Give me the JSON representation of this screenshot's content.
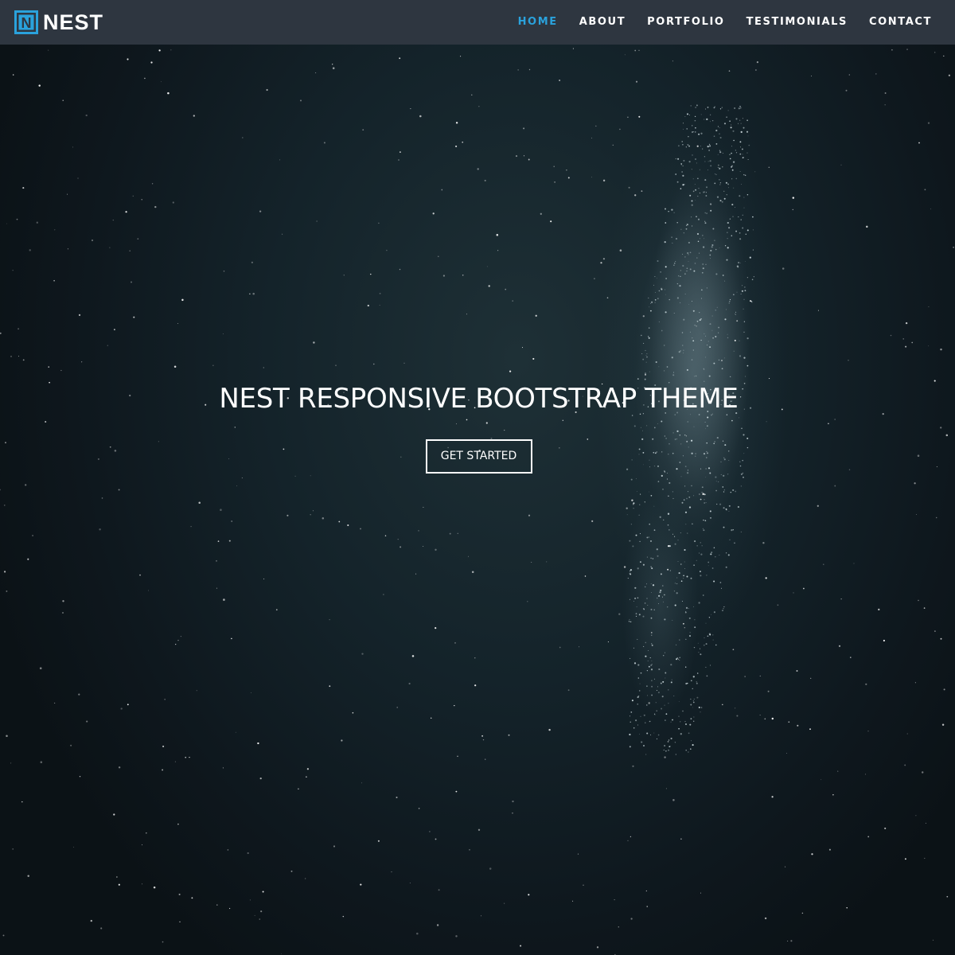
{
  "brand": {
    "logo_letter": "N",
    "name": "NEST",
    "accent_color": "#2aa2dc"
  },
  "nav": {
    "items": [
      {
        "label": "HOME",
        "active": true
      },
      {
        "label": "ABOUT",
        "active": false
      },
      {
        "label": "PORTFOLIO",
        "active": false
      },
      {
        "label": "TESTIMONIALS",
        "active": false
      },
      {
        "label": "CONTACT",
        "active": false
      }
    ]
  },
  "hero": {
    "title": "NEST RESPONSIVE BOOTSTRAP THEME",
    "button_label": "GET STARTED",
    "background": "starry night sky"
  }
}
